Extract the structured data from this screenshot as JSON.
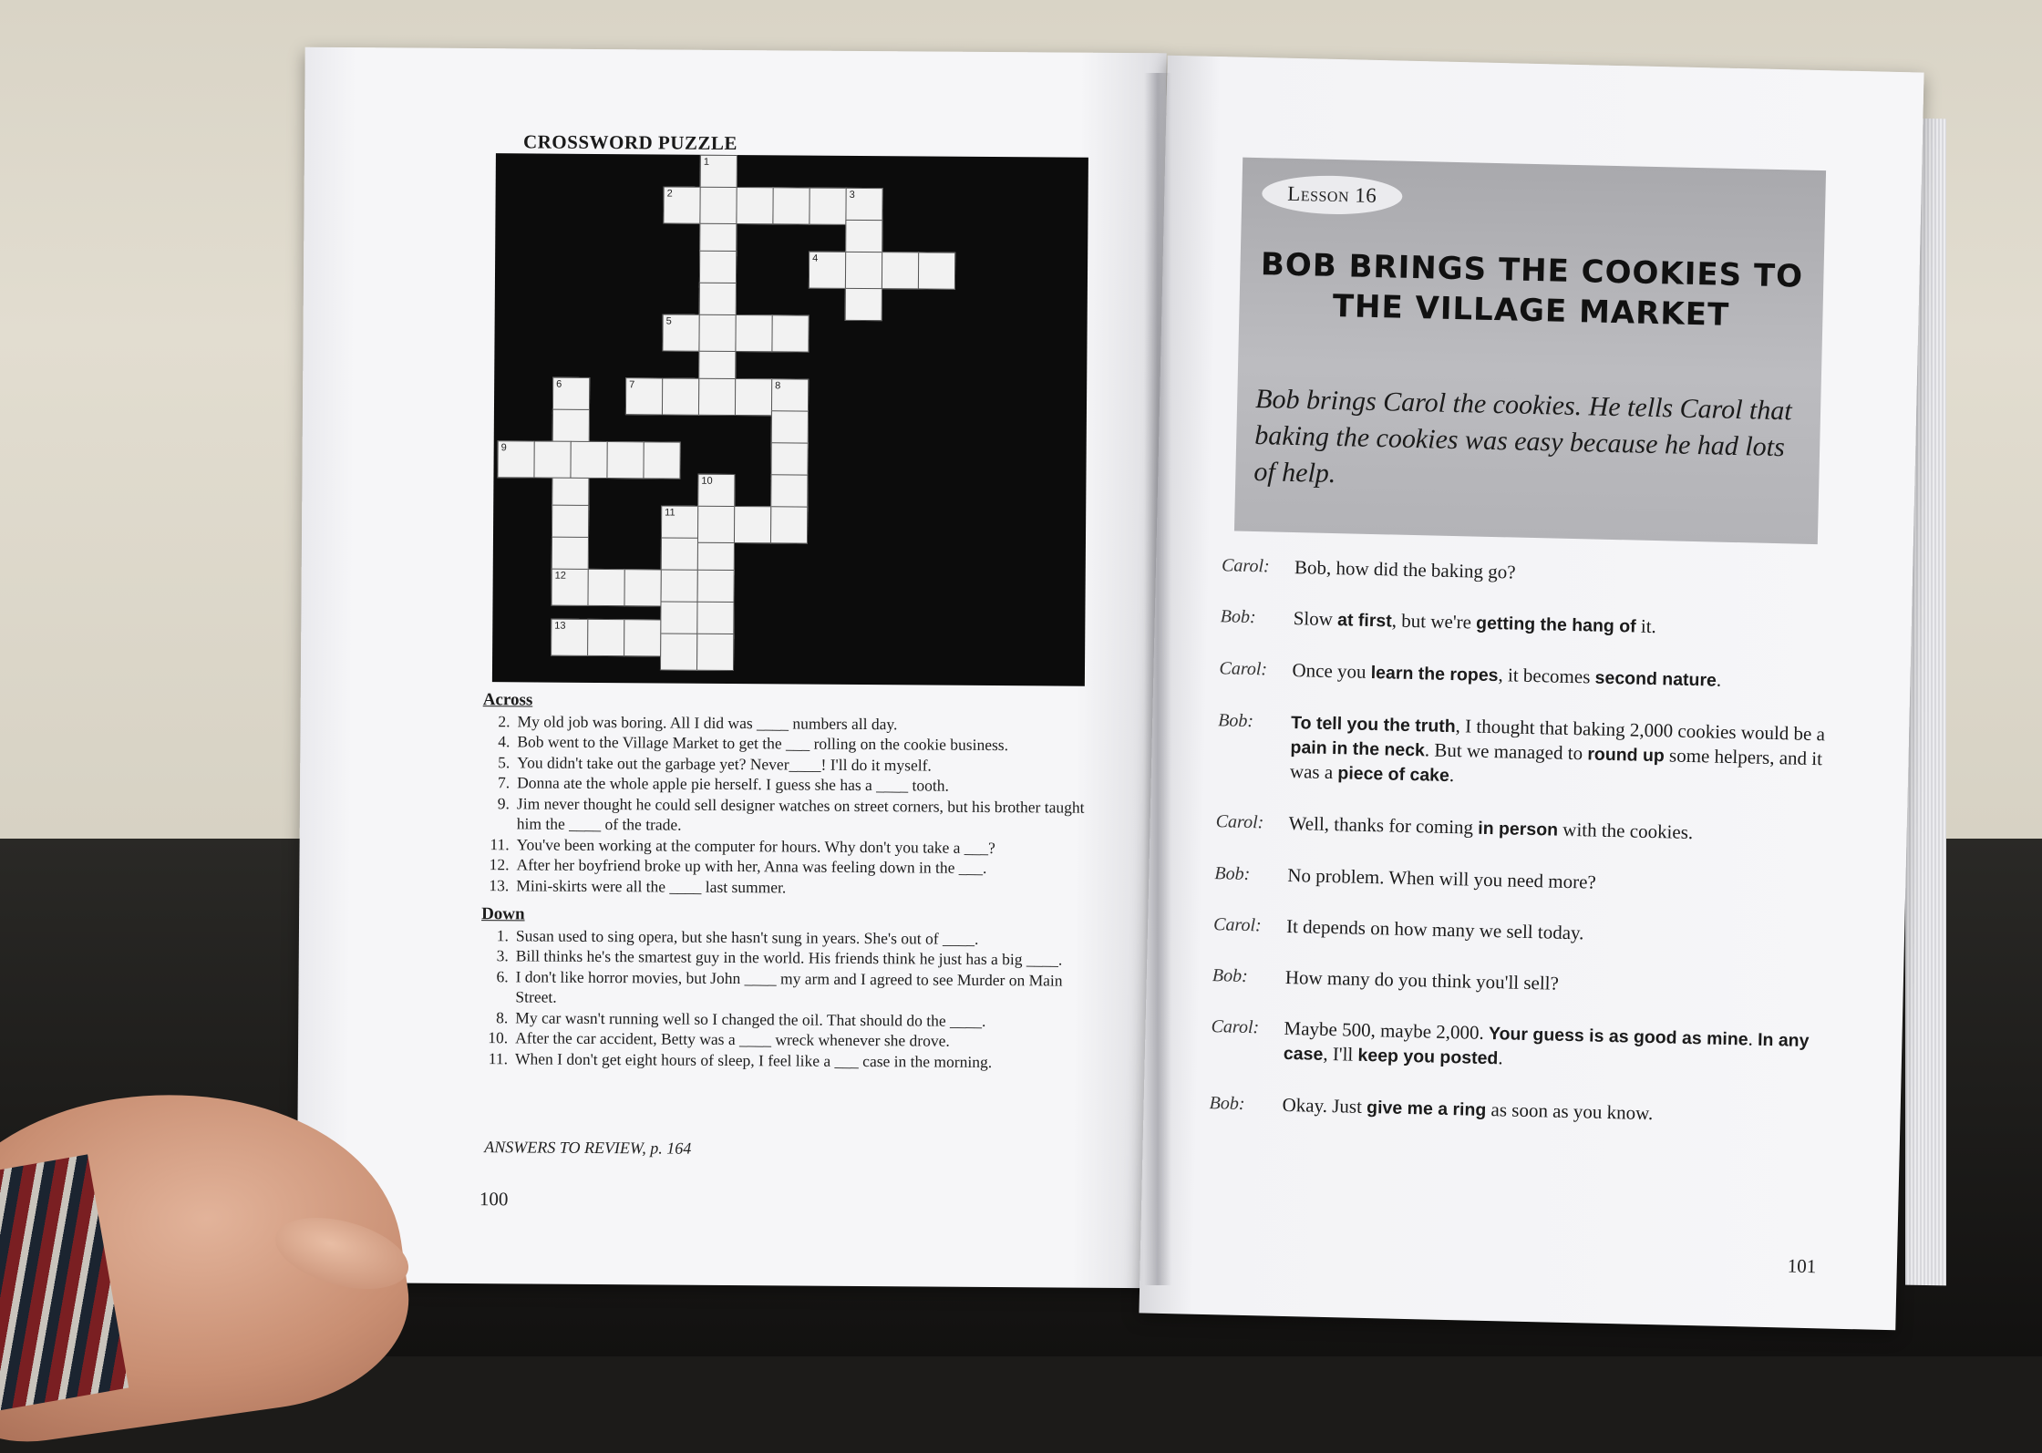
{
  "left_page": {
    "title": "CROSSWORD PUZZLE",
    "grid_numbers": [
      "1",
      "2",
      "3",
      "4",
      "5",
      "6",
      "7",
      "8",
      "9",
      "10",
      "11",
      "12",
      "13"
    ],
    "across_heading": "Across",
    "across": [
      {
        "n": "2.",
        "text": "My old job was boring. All I did was ____ numbers all day."
      },
      {
        "n": "4.",
        "text": "Bob went to the Village Market to get the ___ rolling on the cookie business."
      },
      {
        "n": "5.",
        "text": "You didn't take out the garbage yet? Never____! I'll do it myself."
      },
      {
        "n": "7.",
        "text": "Donna ate the whole apple pie herself. I guess she has a ____ tooth."
      },
      {
        "n": "9.",
        "text": "Jim never thought he could sell designer watches on street corners, but his brother taught him the ____ of the trade."
      },
      {
        "n": "11.",
        "text": "You've been working at the computer for hours. Why don't you take a ___?"
      },
      {
        "n": "12.",
        "text": "After her boyfriend broke up with her, Anna was feeling down in the ___."
      },
      {
        "n": "13.",
        "text": "Mini-skirts were all the ____ last summer."
      }
    ],
    "down_heading": "Down",
    "down": [
      {
        "n": "1.",
        "text": "Susan used to sing opera, but she hasn't sung in years. She's out of ____."
      },
      {
        "n": "3.",
        "text": "Bill thinks he's the smartest guy in the world. His friends think he just has a big ____."
      },
      {
        "n": "6.",
        "text": "I don't like horror movies, but John ____ my arm and I agreed to see Murder on Main Street."
      },
      {
        "n": "8.",
        "text": "My car wasn't running well so I changed the oil. That should do the ____."
      },
      {
        "n": "10.",
        "text": "After the car accident, Betty was a ____ wreck whenever she drove."
      },
      {
        "n": "11.",
        "text": "When I don't get eight hours of sleep, I feel like a ___ case in the morning."
      }
    ],
    "answers_note": "ANSWERS TO REVIEW, p. 164",
    "page_number": "100"
  },
  "right_page": {
    "lesson_label": "Lesson 16",
    "title_line1": "Bob Brings the Cookies to",
    "title_line2": "the Village Market",
    "summary": "Bob brings Carol the cookies. He tells Carol that baking the cookies was easy because he had lots of help.",
    "dialogue": [
      {
        "speaker": "Carol:",
        "parts": [
          "Bob, how did the baking go?"
        ]
      },
      {
        "speaker": "Bob:",
        "parts": [
          "Slow ",
          "at first",
          ", but we're ",
          "getting the hang of",
          " it."
        ]
      },
      {
        "speaker": "Carol:",
        "parts": [
          "Once you ",
          "learn the ropes",
          ", it becomes ",
          "second nature",
          "."
        ]
      },
      {
        "speaker": "Bob:",
        "parts": [
          "",
          "To tell you the truth",
          ", I thought that baking 2,000 cookies would be a ",
          "pain in the neck",
          ". But we managed to ",
          "round up",
          " some helpers, and it was a ",
          "piece of cake",
          "."
        ]
      },
      {
        "speaker": "Carol:",
        "parts": [
          "Well, thanks for coming ",
          "in person",
          " with the cookies."
        ]
      },
      {
        "speaker": "Bob:",
        "parts": [
          "No problem. When will you need more?"
        ]
      },
      {
        "speaker": "Carol:",
        "parts": [
          "It depends on how many we sell today."
        ]
      },
      {
        "speaker": "Bob:",
        "parts": [
          "How many do you think you'll sell?"
        ]
      },
      {
        "speaker": "Carol:",
        "parts": [
          "Maybe 500, maybe 2,000. ",
          "Your guess is as good as mine",
          ". ",
          "In any case",
          ", I'll ",
          "keep you posted",
          "."
        ]
      },
      {
        "speaker": "Bob:",
        "parts": [
          "Okay. Just ",
          "give me a ring",
          " as soon as you know."
        ]
      }
    ],
    "page_number": "101"
  },
  "colors": {
    "grid_black": "#0c0c0c",
    "cell_white": "#f2f2f2",
    "lesson_box_gray": "#b3b3b7",
    "page": "#f6f6f8"
  }
}
